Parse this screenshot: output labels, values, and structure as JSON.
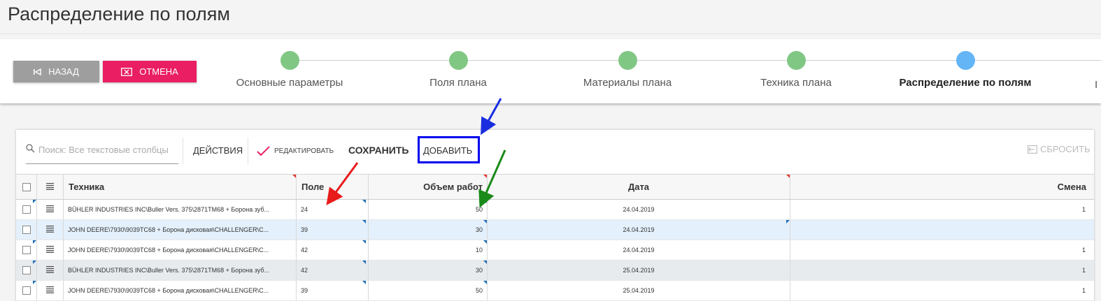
{
  "page": {
    "title": "Распределение по полям"
  },
  "nav": {
    "back_label": "НАЗАД",
    "cancel_label": "ОТМЕНА"
  },
  "wizard": {
    "steps": [
      {
        "label": "Основные параметры",
        "status": "done"
      },
      {
        "label": "Поля плана",
        "status": "done"
      },
      {
        "label": "Материалы плана",
        "status": "done"
      },
      {
        "label": "Техника плана",
        "status": "done"
      },
      {
        "label": "Распределение по полям",
        "status": "active"
      }
    ],
    "next_cut": "I"
  },
  "toolbar": {
    "search_placeholder": "Поиск: Все текстовые столбцы",
    "actions_label": "ДЕЙСТВИЯ",
    "edit_label": "РЕДАКТИРОВАТЬ",
    "save_label": "СОХРАНИТЬ",
    "add_label": "ДОБАВИТЬ",
    "reset_label": "СБРОСИТЬ"
  },
  "grid": {
    "columns": [
      "Техника",
      "Поле",
      "Объем работ",
      "Дата",
      "Смена"
    ],
    "rows": [
      {
        "technique": "BÜHLER INDUSTRIES INC\\Buller Vers. 375\\2871TM68 + Борона зуб...",
        "field": "24",
        "volume": "50",
        "date": "24.04.2019",
        "shift": "1"
      },
      {
        "technique": "JOHN DEERE\\7930\\9039ТС68 + Борона дисковая\\CHALLENGER\\C...",
        "field": "39",
        "volume": "30",
        "date": "24.04.2019",
        "shift": ""
      },
      {
        "technique": "JOHN DEERE\\7930\\9039ТС68 + Борона дисковая\\CHALLENGER\\C...",
        "field": "42",
        "volume": "10",
        "date": "24.04.2019",
        "shift": "1"
      },
      {
        "technique": "BÜHLER INDUSTRIES INC\\Buller Vers. 375\\2871TM68 + Борона зуб...",
        "field": "42",
        "volume": "30",
        "date": "25.04.2019",
        "shift": "1"
      },
      {
        "technique": "JOHN DEERE\\7930\\9039ТС68 + Борона дисковая\\CHALLENGER\\C...",
        "field": "39",
        "volume": "50",
        "date": "25.04.2019",
        "shift": "1"
      }
    ]
  },
  "colors": {
    "step_done": "#81c784",
    "step_active": "#64b5f6",
    "cancel_bg": "#e91e63",
    "back_bg": "#9e9e9e",
    "highlight_box": "#0000ee",
    "arrow_blue": "#1a2ee0",
    "arrow_red": "#e81b1b",
    "arrow_green": "#1a8a1a"
  }
}
